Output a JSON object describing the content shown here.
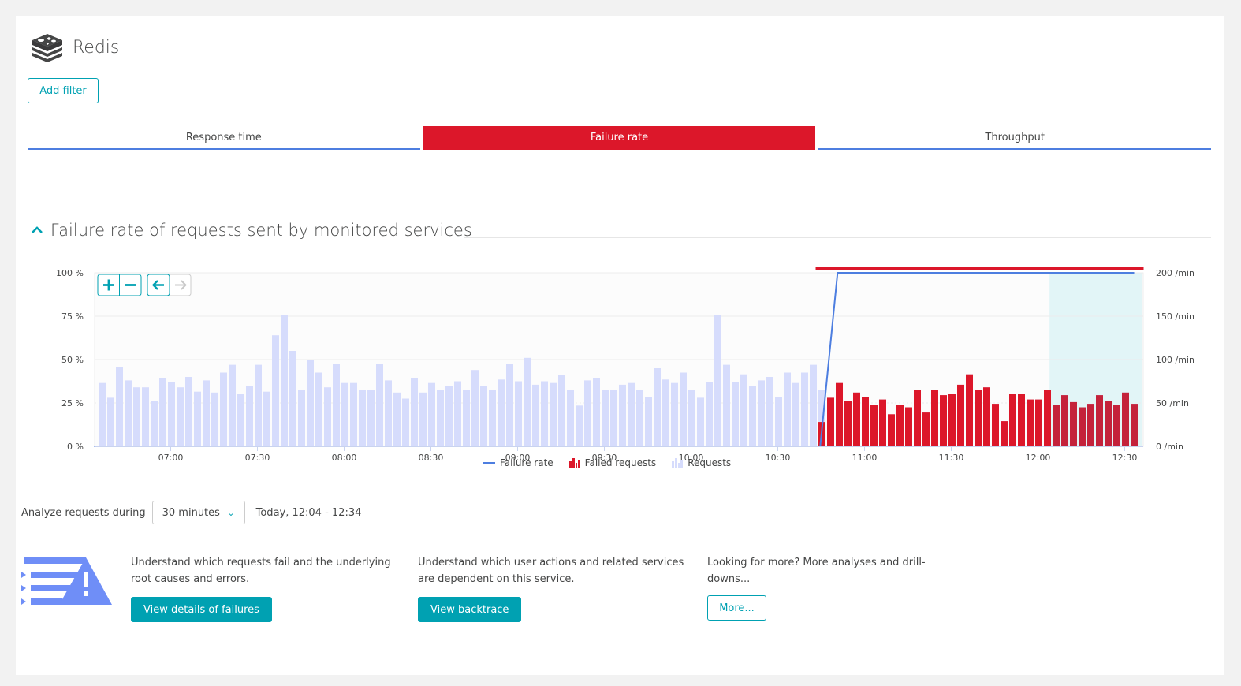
{
  "header": {
    "title": "Redis",
    "icon": "redis-icon"
  },
  "filter": {
    "add_label": "Add filter"
  },
  "tabs": [
    {
      "label": "Response time",
      "active": false
    },
    {
      "label": "Failure rate",
      "active": true
    },
    {
      "label": "Throughput",
      "active": false
    }
  ],
  "section": {
    "title": "Failure rate of requests sent by monitored services",
    "icon": "chevron-up-icon"
  },
  "chart_controls": {
    "zoom_in": "+",
    "zoom_out": "−",
    "back": "←",
    "forward": "→"
  },
  "colors": {
    "accent": "#00a1b2",
    "failure": "#dc172a",
    "failure_selected": "#c4223b",
    "requests": "#d6dcfc",
    "rate_line": "#4d7ee0",
    "selection": "#e2f5f7"
  },
  "chart_data": {
    "type": "bar",
    "title": "Failure rate of requests sent by monitored services",
    "x_start": "06:36",
    "interval_minutes": 3,
    "x_ticks": [
      "07:00",
      "07:30",
      "08:00",
      "08:30",
      "09:00",
      "09:30",
      "10:00",
      "10:30",
      "11:00",
      "11:30",
      "12:00",
      "12:30"
    ],
    "y_left": {
      "label": "Failure rate",
      "ticks": [
        "0 %",
        "25 %",
        "50 %",
        "75 %",
        "100 %"
      ],
      "range": [
        0,
        100
      ],
      "unit": "%"
    },
    "y_right": {
      "label": "Requests",
      "ticks": [
        "0 /min",
        "50 /min",
        "100 /min",
        "150 /min",
        "200 /min"
      ],
      "range": [
        0,
        200
      ],
      "unit": "/min"
    },
    "legend": [
      {
        "name": "Failure rate",
        "type": "line"
      },
      {
        "name": "Failed requests",
        "type": "bar"
      },
      {
        "name": "Requests",
        "type": "bar"
      }
    ],
    "legend_position": "bottom",
    "grid": true,
    "series": [
      {
        "name": "Requests",
        "axis": "right",
        "values": [
          73,
          56,
          91,
          76,
          68,
          68,
          52,
          79,
          74,
          68,
          80,
          63,
          76,
          62,
          85,
          94,
          60,
          70,
          94,
          63,
          128,
          151,
          110,
          65,
          100,
          85,
          68,
          95,
          73,
          73,
          65,
          65,
          95,
          76,
          62,
          55,
          79,
          62,
          73,
          65,
          70,
          75,
          65,
          88,
          70,
          65,
          77,
          95,
          75,
          102,
          71,
          75,
          73,
          82,
          65,
          47,
          76,
          79,
          65,
          65,
          71,
          73,
          65,
          57,
          90,
          77,
          73,
          85,
          65,
          56,
          74,
          151,
          94,
          74,
          83,
          70,
          76,
          80,
          57,
          85,
          73,
          85,
          94,
          65,
          56,
          73,
          52,
          62,
          57,
          48,
          54,
          37,
          48,
          45,
          65,
          39,
          65,
          59,
          60,
          71,
          83,
          65,
          68,
          49,
          29,
          60,
          60,
          54,
          54,
          65,
          48,
          59,
          51,
          45,
          49,
          59,
          52,
          48,
          62,
          49
        ]
      },
      {
        "name": "Failed requests",
        "axis": "right",
        "start_index": 83,
        "values": [
          29,
          56,
          73,
          52,
          62,
          57,
          48,
          54,
          37,
          48,
          45,
          65,
          39,
          65,
          59,
          60,
          71,
          83,
          65,
          68,
          49,
          29,
          60,
          60,
          54,
          54,
          65,
          48,
          59,
          51,
          45,
          49,
          59,
          52,
          48,
          62,
          49
        ]
      },
      {
        "name": "Failure rate",
        "axis": "left",
        "type": "line",
        "points": [
          {
            "index": 0,
            "value": 0
          },
          {
            "index": 82.8,
            "value": 0
          },
          {
            "index": 84.8,
            "value": 100
          },
          {
            "index": 119,
            "value": 100
          }
        ]
      }
    ],
    "selection": {
      "from": "12:04",
      "to": "12:34"
    },
    "alert_band": {
      "from_index": 83,
      "to_index": 119,
      "label": "failure"
    }
  },
  "analyze": {
    "label": "Analyze requests during",
    "selected": "30 minutes",
    "range": "Today, 12:04 - 12:34"
  },
  "actions": [
    {
      "text": "Understand which requests fail and the underlying root causes and errors.",
      "button": "View details of failures"
    },
    {
      "text": "Understand which user actions and related services are dependent on this service.",
      "button": "View backtrace"
    },
    {
      "text": "Looking for more? More analyses and drill-downs...",
      "button": "More..."
    }
  ]
}
